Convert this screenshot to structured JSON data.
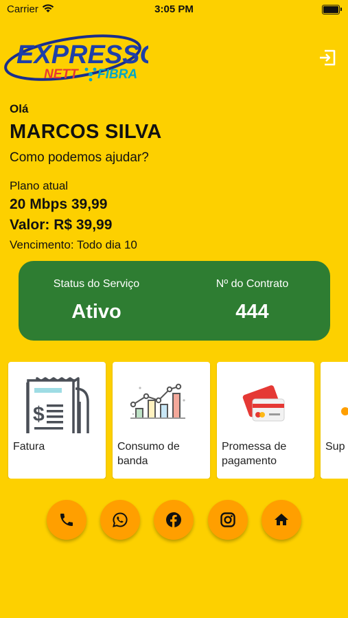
{
  "status_bar": {
    "carrier": "Carrier",
    "time": "3:05 PM"
  },
  "brand": {
    "line1": "EXPRESSO",
    "line2a": "NETT",
    "line2b": "FIBRA"
  },
  "greeting": {
    "hello": "Olá",
    "name": "MARCOS SILVA",
    "subtitle": "Como podemos ajudar?"
  },
  "plan": {
    "label": "Plano atual",
    "name": "20 Mbps 39,99",
    "value": "Valor: R$ 39,99",
    "due": "Vencimento: Todo dia 10"
  },
  "service": {
    "status_label": "Status do Serviço",
    "status_value": "Ativo",
    "contract_label": "Nº do Contrato",
    "contract_value": "444",
    "card_color": "#2E7D32"
  },
  "menu": [
    {
      "label": "Fatura",
      "icon": "invoice-icon"
    },
    {
      "label": "Consumo de\nbanda",
      "icon": "bandwidth-chart-icon"
    },
    {
      "label": "Promessa de\npagamento",
      "icon": "credit-card-icon"
    },
    {
      "label": "Sup",
      "icon": "support-icon"
    }
  ],
  "actions": [
    {
      "icon": "phone-icon"
    },
    {
      "icon": "whatsapp-icon"
    },
    {
      "icon": "facebook-icon"
    },
    {
      "icon": "instagram-icon"
    },
    {
      "icon": "home-icon"
    }
  ],
  "colors": {
    "background": "#FDD000",
    "accent": "#FF9F00",
    "success": "#2E7D32"
  }
}
